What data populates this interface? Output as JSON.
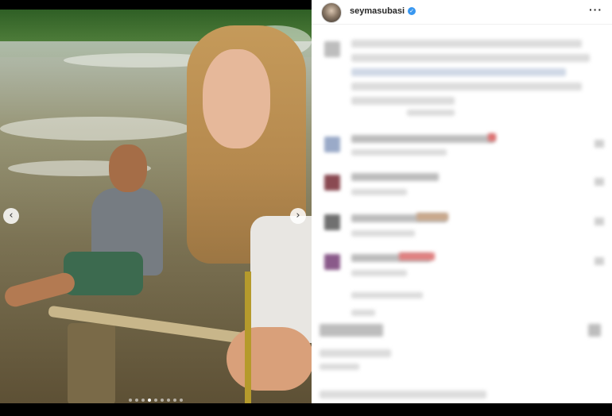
{
  "post": {
    "username": "seymasubasi",
    "verified": true,
    "more_label": "···"
  },
  "media": {
    "prev_label": "‹",
    "next_label": "›",
    "carousel_count": 9,
    "carousel_active_index": 3
  },
  "icons": {
    "verified": "verified-badge-icon",
    "more": "more-options-icon",
    "prev": "chevron-left-icon",
    "next": "chevron-right-icon"
  },
  "colors": {
    "verified": "#3897f0",
    "panel_bg": "#ffffff",
    "username": "#262626"
  }
}
